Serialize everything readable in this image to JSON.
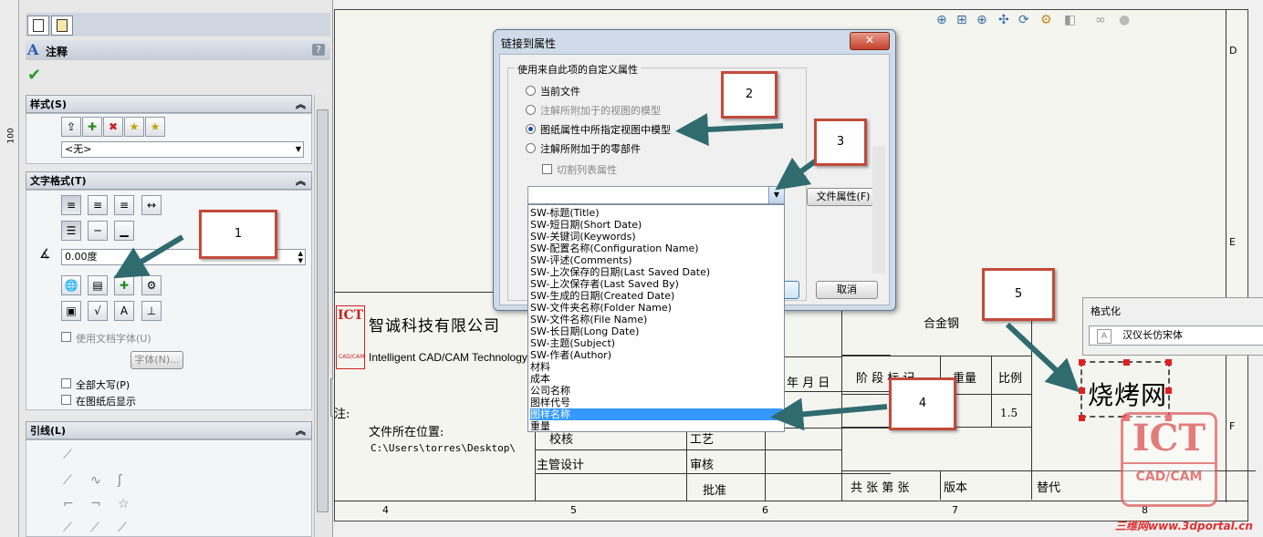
{
  "ruler": {
    "mark": "100"
  },
  "pm": {
    "title": "注释",
    "help": "?",
    "style_section": {
      "title": "样式(S)",
      "value": "<无>"
    },
    "text_format_section": {
      "title": "文字格式(T)",
      "angle_value": "0.00度",
      "use_doc_font": "使用文档字体(U)",
      "font_button": "字体(N)...",
      "all_caps": "全部大写(P)",
      "show_behind": "在图纸后显示"
    },
    "leader_section": {
      "title": "引线(L)"
    }
  },
  "dialog": {
    "title": "链接到属性",
    "close": "✕",
    "group_label": "使用来自此项的自定义属性",
    "radios": [
      "当前文件",
      "注解所附加于的视图的模型",
      "图纸属性中所指定视图中模型",
      "注解所附加于的零部件"
    ],
    "cut_list": "切割列表属性",
    "file_props_button": "文件属性(F)",
    "cancel_button": "取消",
    "list_items": [
      "SW-标题(Title)",
      "SW-短日期(Short Date)",
      "SW-关键词(Keywords)",
      "SW-配置名称(Configuration Name)",
      "SW-评述(Comments)",
      "SW-上次保存的日期(Last Saved Date)",
      "SW-上次保存者(Last Saved By)",
      "SW-生成的日期(Created Date)",
      "SW-文件夹名称(Folder Name)",
      "SW-文件名称(File Name)",
      "SW-长日期(Long Date)",
      "SW-主题(Subject)",
      "SW-作者(Author)",
      "材料",
      "成本",
      "公司名称",
      "图样代号",
      "图样名称",
      "重量"
    ],
    "selected_index": 17
  },
  "title_block": {
    "company_cn": "智诚科技有限公司",
    "company_en": "Intelligent CAD/CAM Technology Ltd.",
    "logo_ict": "ICT",
    "logo_sub": "CAD/CAM",
    "material": "合金钢",
    "note_label": "注:",
    "file_loc_label": "文件所在位置:",
    "file_path": "C:\\Users\\torres\\Desktop\\",
    "year_month_day": "年 月 日",
    "stage_mark": "阶 段 标 记",
    "weight": "重量",
    "scale": "比例",
    "scale_value": "1.5",
    "proofread": "校核",
    "process": "工艺",
    "chief_design": "主管设计",
    "review": "审核",
    "approve": "批准",
    "sheets": "共 张  第 张",
    "version": "版本",
    "replace": "替代",
    "drawing_name": "烧烤网",
    "col_numbers": [
      "4",
      "5",
      "6",
      "7",
      "8"
    ],
    "row_letters": [
      "D",
      "E",
      "F"
    ]
  },
  "format_panel": {
    "title": "格式化",
    "font": "汉仪长仿宋体"
  },
  "callouts": [
    "1",
    "2",
    "3",
    "4",
    "5"
  ],
  "watermark": {
    "ict": "ICT",
    "sub": "CAD/CAM",
    "site": "三维网www.3dportal.cn"
  }
}
